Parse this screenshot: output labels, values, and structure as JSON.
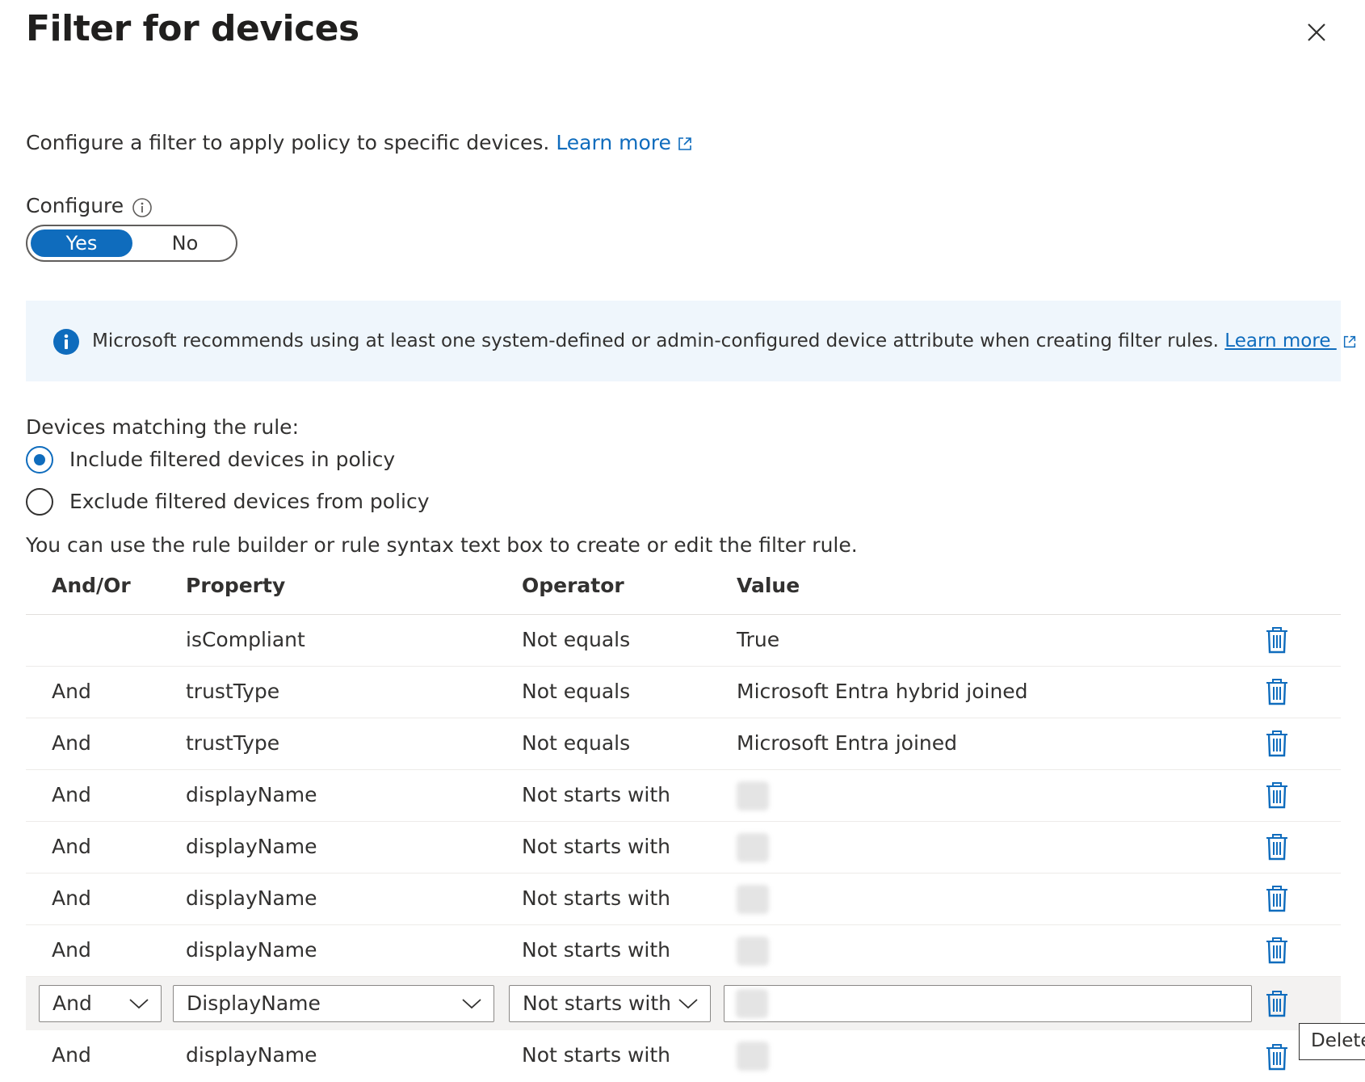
{
  "panel": {
    "title": "Filter for devices",
    "close_icon": "close-icon"
  },
  "intro": {
    "text": "Configure a filter to apply policy to specific devices. ",
    "learn_more": "Learn more"
  },
  "configure": {
    "label": "Configure",
    "info_icon": "info-icon",
    "yes": "Yes",
    "no": "No",
    "selected": "Yes"
  },
  "banner": {
    "icon": "info-filled-icon",
    "text": "Microsoft recommends using at least one system-defined or admin-configured device attribute when creating filter rules. ",
    "learn_more": "Learn more "
  },
  "matching": {
    "label": "Devices matching the rule:",
    "options": [
      "Include filtered devices in policy",
      "Exclude filtered devices from policy"
    ],
    "selected": "Include filtered devices in policy"
  },
  "hint": "You can use the rule builder or rule syntax text box to create or edit the filter rule.",
  "table": {
    "headers": [
      "And/Or",
      "Property",
      "Operator",
      "Value"
    ],
    "rows": [
      {
        "andor": "",
        "property": "isCompliant",
        "operator": "Not equals",
        "value": "True"
      },
      {
        "andor": "And",
        "property": "trustType",
        "operator": "Not equals",
        "value": "Microsoft Entra hybrid joined"
      },
      {
        "andor": "And",
        "property": "trustType",
        "operator": "Not equals",
        "value": "Microsoft Entra joined"
      },
      {
        "andor": "And",
        "property": "displayName",
        "operator": "Not starts with",
        "value": ""
      },
      {
        "andor": "And",
        "property": "displayName",
        "operator": "Not starts with",
        "value": ""
      },
      {
        "andor": "And",
        "property": "displayName",
        "operator": "Not starts with",
        "value": ""
      },
      {
        "andor": "And",
        "property": "displayName",
        "operator": "Not starts with",
        "value": ""
      }
    ],
    "edit_row": {
      "andor": "And",
      "property": "DisplayName",
      "operator": "Not starts with",
      "value": ""
    },
    "last_row": {
      "andor": "And",
      "property": "displayName",
      "operator": "Not starts with",
      "value": ""
    },
    "delete_icon": "trash-icon"
  },
  "tooltip": "Delete"
}
